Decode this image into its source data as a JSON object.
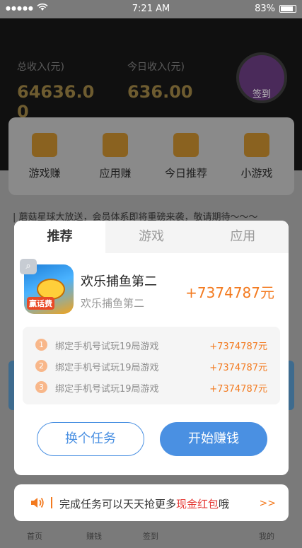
{
  "status_bar": {
    "signal": "●●●●●",
    "time": "7:21 AM",
    "battery": "83%"
  },
  "background": {
    "total_income_label": "总收入(元)",
    "total_income_value": "64636.00",
    "today_income_label": "今日收入(元)",
    "today_income_value": "636.00",
    "signin_label": "签到",
    "quick_menu": [
      {
        "label": "游戏赚",
        "icon": "yuan-shield-icon"
      },
      {
        "label": "应用赚",
        "icon": "cube-icon"
      },
      {
        "label": "今日推荐",
        "icon": "hot-badge-icon"
      },
      {
        "label": "小游戏",
        "icon": "gamepad-icon"
      }
    ],
    "marquee": "| 蘑菇星球大放送，会员体系即将重磅来袭，敬请期待～～～",
    "tabbar": [
      "首页",
      "赚钱",
      "签到",
      "我的"
    ]
  },
  "dialog": {
    "tabs": [
      "推荐",
      "游戏",
      "应用"
    ],
    "active_tab": 0,
    "game": {
      "name": "欢乐捕鱼第二",
      "subtitle": "欢乐捕鱼第二",
      "reward": "+7374787元",
      "icon_tag": "赢话费"
    },
    "tasks": [
      {
        "num": "1",
        "text": "绑定手机号试玩19局游戏",
        "amount": "+7374787元"
      },
      {
        "num": "2",
        "text": "绑定手机号试玩19局游戏",
        "amount": "+7374787元"
      },
      {
        "num": "3",
        "text": "绑定手机号试玩19局游戏",
        "amount": "+7374787元"
      }
    ],
    "change_button": "换个任务",
    "start_button": "开始赚钱"
  },
  "notice": {
    "prefix": "完成任务可以天天抢更多",
    "highlight": "现金红包",
    "suffix": "哦",
    "more": ">>"
  },
  "colors": {
    "accent": "#4a90e2",
    "reward": "#f37a1f",
    "highlight": "#e53935"
  }
}
